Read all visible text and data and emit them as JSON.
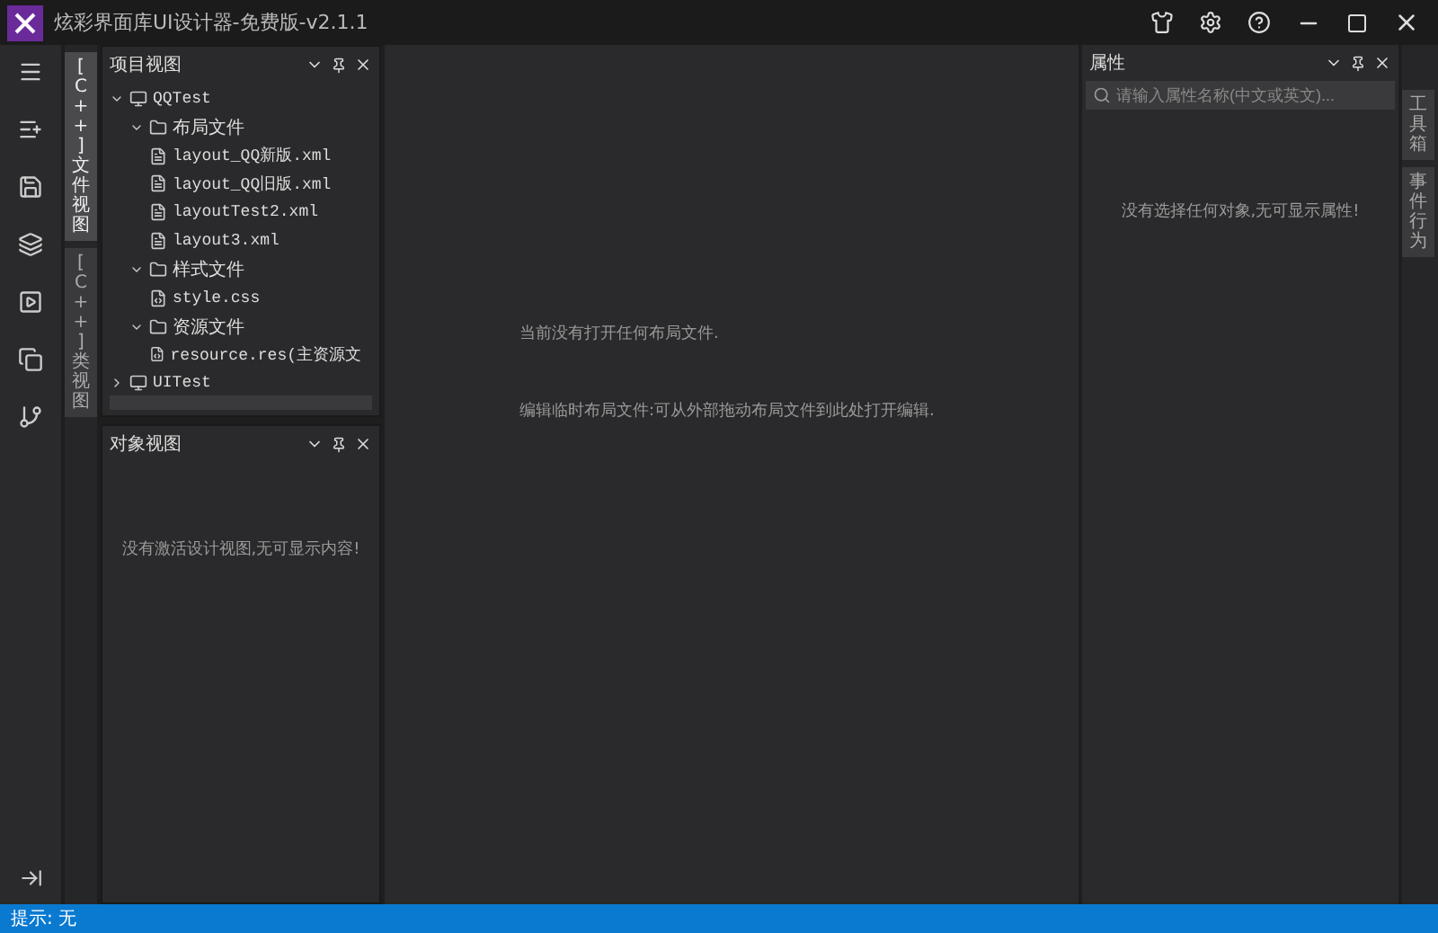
{
  "window": {
    "title": "炫彩界面库UI设计器-免费版-v2.1.1"
  },
  "left_tabs": [
    {
      "label": "[C++]文件视图",
      "selected": true
    },
    {
      "label": "[C++]类视图",
      "selected": false
    }
  ],
  "project_panel": {
    "title": "项目视图",
    "tree": [
      {
        "label": "QQTest",
        "kind": "project",
        "expanded": true,
        "children": [
          {
            "label": "布局文件",
            "kind": "folder",
            "expanded": true,
            "children": [
              {
                "label": "layout_QQ新版.xml",
                "kind": "file"
              },
              {
                "label": "layout_QQ旧版.xml",
                "kind": "file"
              },
              {
                "label": "layoutTest2.xml",
                "kind": "file"
              },
              {
                "label": "layout3.xml",
                "kind": "file"
              }
            ]
          },
          {
            "label": "样式文件",
            "kind": "folder",
            "expanded": true,
            "children": [
              {
                "label": "style.css",
                "kind": "style"
              }
            ]
          },
          {
            "label": "资源文件",
            "kind": "folder",
            "expanded": true,
            "children": [
              {
                "label": "resource.res(主资源文",
                "kind": "style"
              }
            ]
          }
        ]
      },
      {
        "label": "UITest",
        "kind": "project",
        "expanded": false
      }
    ]
  },
  "object_panel": {
    "title": "对象视图",
    "message": "没有激活设计视图,无可显示内容!"
  },
  "editor": {
    "messages": [
      "当前没有打开任何布局文件.",
      "编辑临时布局文件:可从外部拖动布局文件到此处打开编辑."
    ]
  },
  "properties_panel": {
    "title": "属性",
    "search": {
      "placeholder": "请输入属性名称(中文或英文)..."
    },
    "message": "没有选择任何对象,无可显示属性!"
  },
  "right_tabs": [
    {
      "label": "工具箱",
      "selected": false
    },
    {
      "label": "事件行为",
      "selected": false
    }
  ],
  "status_bar": {
    "text": "提示: 无"
  }
}
